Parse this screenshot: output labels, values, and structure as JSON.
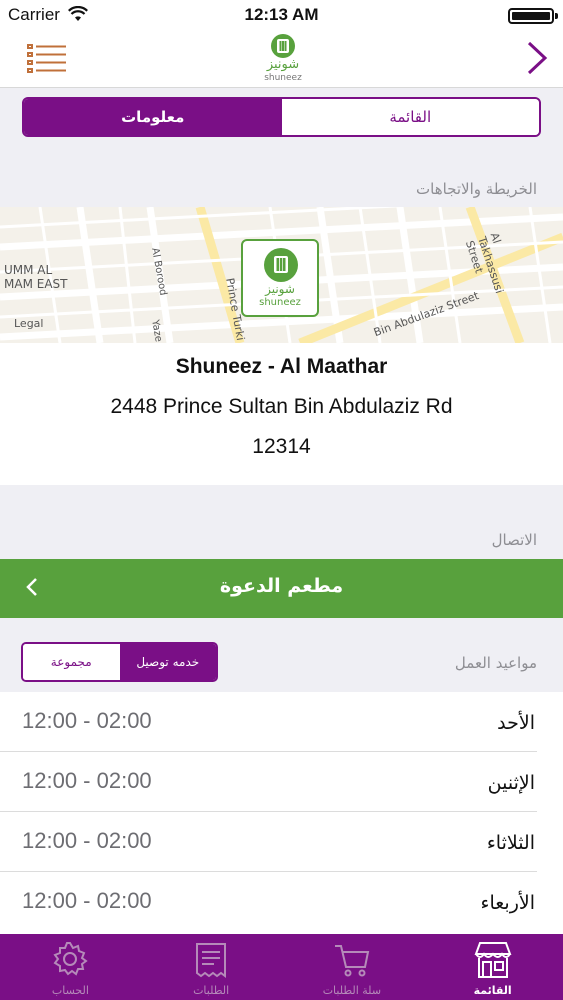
{
  "status_bar": {
    "carrier": "Carrier",
    "time": "12:13 AM"
  },
  "header": {
    "logo_arabic": "شونيز",
    "logo_latin": "shuneez"
  },
  "segmented": {
    "menu": "القائمة",
    "info": "معلومات"
  },
  "map_section": {
    "label": "الخريطة والاتجاهات",
    "legal": "Legal",
    "streets": [
      "UMM AL",
      "MAM EAST",
      "Al Borood",
      "Prince Turki",
      "Yaze",
      "Bin Abdulaziz Street",
      "Al Takhassusi Street"
    ],
    "pin_arabic": "شونيز",
    "pin_latin": "shuneez"
  },
  "address": {
    "name": "Shuneez - Al Maathar",
    "line1": "2448 Prince Sultan Bin Abdulaziz Rd",
    "zip": "12314"
  },
  "contact": {
    "label": "الاتصال",
    "bar_title": "مطعم الدعوة"
  },
  "hours": {
    "label": "مواعيد العمل",
    "delivery": "خدمه توصيل",
    "group": "مجموعة",
    "rows": [
      {
        "day": "الأحد",
        "hours": "12:00 - 02:00"
      },
      {
        "day": "الإثنين",
        "hours": "12:00 - 02:00"
      },
      {
        "day": "الثلاثاء",
        "hours": "12:00 - 02:00"
      },
      {
        "day": "الأربعاء",
        "hours": "12:00 - 02:00"
      }
    ]
  },
  "tabbar": {
    "account": "الحساب",
    "orders": "الطلبات",
    "cart": "سلة الطلبات",
    "menu": "القائمة"
  },
  "colors": {
    "brand_purple": "#7a0f86",
    "brand_green": "#58a13d"
  }
}
